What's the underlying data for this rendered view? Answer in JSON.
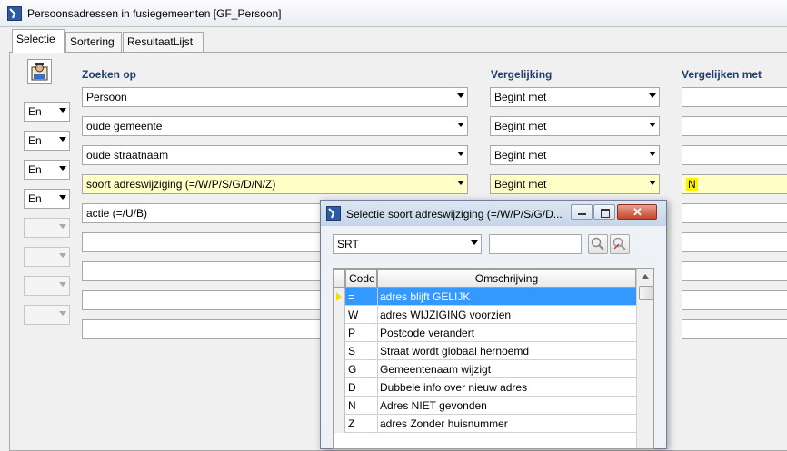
{
  "window": {
    "title": "Persoonsadressen in fusiegemeenten [GF_Persoon]"
  },
  "tabs": [
    {
      "label": "Selectie",
      "active": true
    },
    {
      "label": "Sortering",
      "active": false
    },
    {
      "label": "ResultaatLijst",
      "active": false
    }
  ],
  "headers": {
    "zoeken_op": "Zoeken op",
    "vergelijking": "Vergelijking",
    "vergelijken_met": "Vergelijken met"
  },
  "rows": [
    {
      "logic": "",
      "field": "Persoon",
      "compare": "Begint met",
      "value": ""
    },
    {
      "logic": "En",
      "field": "oude gemeente",
      "compare": "Begint met",
      "value": ""
    },
    {
      "logic": "En",
      "field": "oude straatnaam",
      "compare": "Begint met",
      "value": ""
    },
    {
      "logic": "En",
      "field": "soort adreswijziging  (=/W/P/S/G/D/N/Z)",
      "compare": "Begint met",
      "value": "N"
    },
    {
      "logic": "En",
      "field": "actie  (=/U/B)",
      "compare": "",
      "value": ""
    },
    {
      "logic": "",
      "field": "",
      "compare": "",
      "value": ""
    },
    {
      "logic": "",
      "field": "",
      "compare": "",
      "value": ""
    },
    {
      "logic": "",
      "field": "",
      "compare": "",
      "value": ""
    },
    {
      "logic": "",
      "field": "",
      "compare": "",
      "value": ""
    }
  ],
  "popup": {
    "title": "Selectie soort adreswijziging  (=/W/P/S/G/D...",
    "filter_select": "SRT",
    "filter_value": "",
    "columns": {
      "code": "Code",
      "omschrijving": "Omschrijving"
    },
    "items": [
      {
        "code": "=",
        "omschrijving": "adres blijft GELIJK"
      },
      {
        "code": "W",
        "omschrijving": "adres WIJZIGING voorzien"
      },
      {
        "code": "P",
        "omschrijving": "Postcode verandert"
      },
      {
        "code": "S",
        "omschrijving": "Straat wordt globaal hernoemd"
      },
      {
        "code": "G",
        "omschrijving": "Gemeentenaam wijzigt"
      },
      {
        "code": "D",
        "omschrijving": "Dubbele info over nieuw adres"
      },
      {
        "code": "N",
        "omschrijving": "Adres NIET gevonden"
      },
      {
        "code": "Z",
        "omschrijving": "adres Zonder huisnummer"
      }
    ]
  },
  "colors": {
    "header_text": "#1e3f6e",
    "highlight_row": "#ffffc8",
    "selection": "#3399ff",
    "value_highlight": "#fff200"
  }
}
